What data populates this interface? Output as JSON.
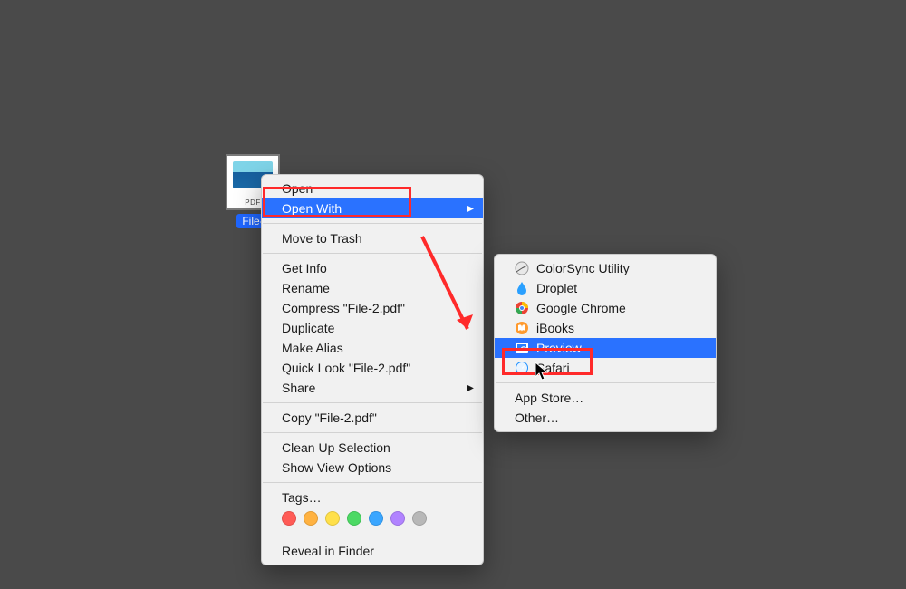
{
  "file": {
    "name": "File-2.pdf",
    "label_short": "File-",
    "badge": "PDF"
  },
  "context_menu": {
    "items": [
      {
        "label": "Open"
      },
      {
        "label": "Open With",
        "submenu": true,
        "highlighted": true
      },
      {
        "sep": true
      },
      {
        "label": "Move to Trash"
      },
      {
        "sep": true
      },
      {
        "label": "Get Info"
      },
      {
        "label": "Rename"
      },
      {
        "label": "Compress \"File-2.pdf\""
      },
      {
        "label": "Duplicate"
      },
      {
        "label": "Make Alias"
      },
      {
        "label": "Quick Look \"File-2.pdf\""
      },
      {
        "label": "Share",
        "submenu": true
      },
      {
        "sep": true
      },
      {
        "label": "Copy \"File-2.pdf\""
      },
      {
        "sep": true
      },
      {
        "label": "Clean Up Selection"
      },
      {
        "label": "Show View Options"
      },
      {
        "sep": true
      },
      {
        "label": "Tags…"
      }
    ],
    "reveal": "Reveal in Finder"
  },
  "open_with_menu": {
    "apps": [
      {
        "label": "ColorSync Utility",
        "icon": "colorsync-icon"
      },
      {
        "label": "Droplet",
        "icon": "droplet-icon"
      },
      {
        "label": "Google Chrome",
        "icon": "chrome-icon"
      },
      {
        "label": "iBooks",
        "icon": "ibooks-icon"
      },
      {
        "label": "Preview",
        "icon": "preview-icon",
        "highlighted": true
      },
      {
        "label": "Safari",
        "icon": "safari-icon"
      }
    ],
    "app_store": "App Store…",
    "other": "Other…"
  },
  "tag_colors": [
    "#ff5b56",
    "#ffb241",
    "#ffe04a",
    "#4cd964",
    "#3aa6ff",
    "#b183ff",
    "#b8b8b8"
  ]
}
